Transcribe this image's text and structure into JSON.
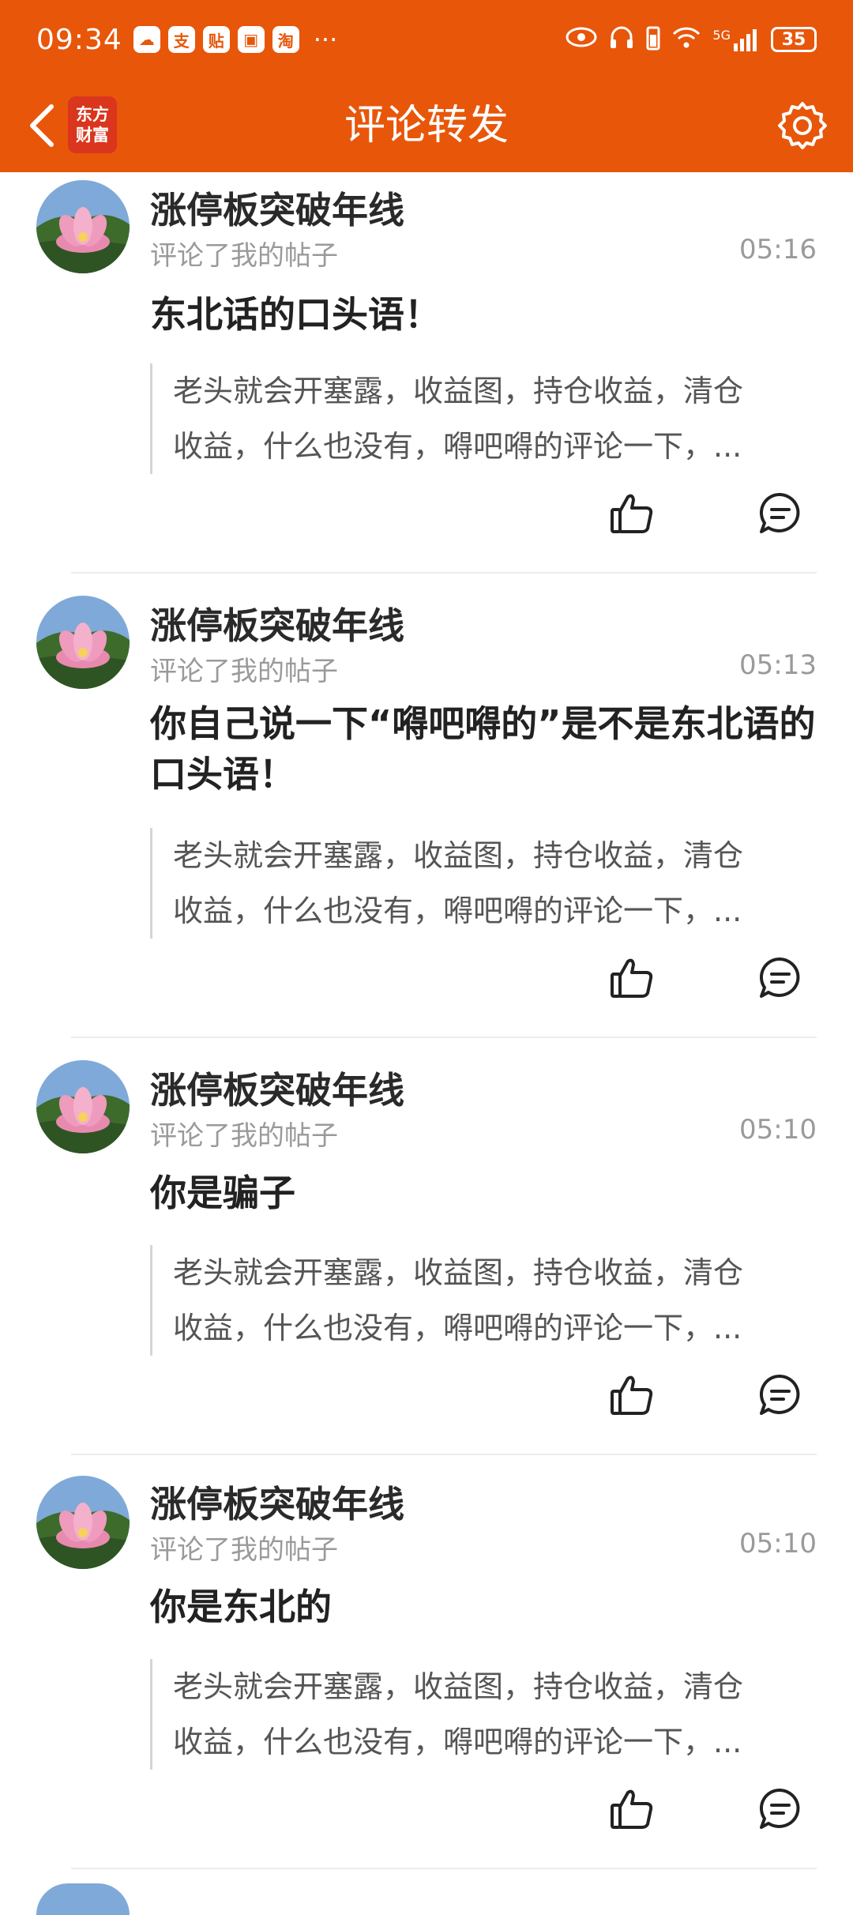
{
  "status_bar": {
    "time": "09:34",
    "app_icons": [
      "cloud-icon",
      "alipay-icon",
      "tieba-icon",
      "photo-icon",
      "taobao-icon"
    ],
    "network": "5G",
    "battery": "35"
  },
  "nav": {
    "brand_line1": "东方",
    "brand_line2": "财富",
    "title": "评论转发"
  },
  "items": [
    {
      "user": "涨停板突破年线",
      "action": "评论了我的帖子",
      "time": "05:16",
      "comment": "东北话的口头语！",
      "quote_line1": "老头就会开塞露，收益图，持仓收益，清仓",
      "quote_line2": "收益，什么也没有，嘚吧嘚的评论一下，..."
    },
    {
      "user": "涨停板突破年线",
      "action": "评论了我的帖子",
      "time": "05:13",
      "comment": "你自己说一下“嘚吧嘚的”是不是东北语的口头语！",
      "quote_line1": "老头就会开塞露，收益图，持仓收益，清仓",
      "quote_line2": "收益，什么也没有，嘚吧嘚的评论一下，..."
    },
    {
      "user": "涨停板突破年线",
      "action": "评论了我的帖子",
      "time": "05:10",
      "comment": "你是骗子",
      "quote_line1": "老头就会开塞露，收益图，持仓收益，清仓",
      "quote_line2": "收益，什么也没有，嘚吧嘚的评论一下，..."
    },
    {
      "user": "涨停板突破年线",
      "action": "评论了我的帖子",
      "time": "05:10",
      "comment": "你是东北的",
      "quote_line1": "老头就会开塞露，收益图，持仓收益，清仓",
      "quote_line2": "收益，什么也没有，嘚吧嘚的评论一下，..."
    }
  ],
  "colors": {
    "accent": "#e8560a",
    "brand": "#d9361d"
  }
}
